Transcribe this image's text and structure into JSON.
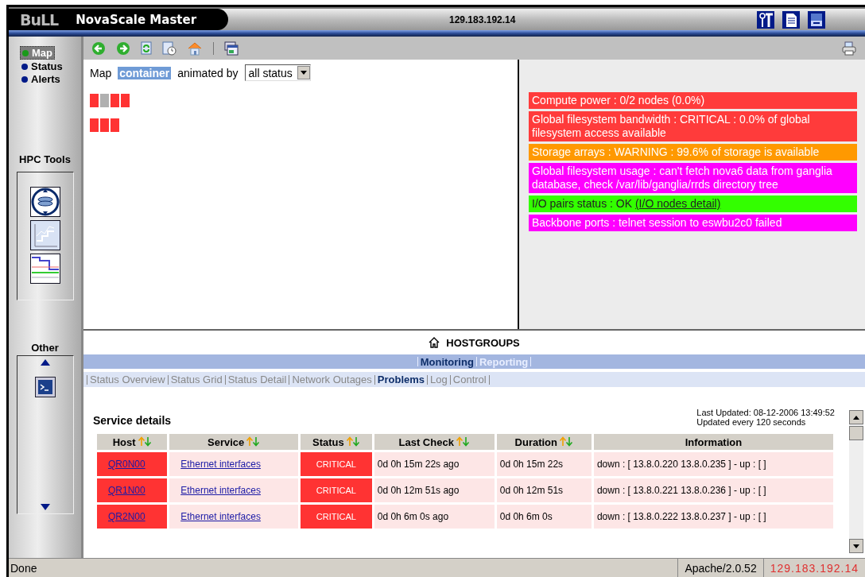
{
  "header": {
    "logo": "BuLL",
    "title": "NovaScale Master",
    "address": "129.183.192.14"
  },
  "sidebar": {
    "items": [
      {
        "label": "Map",
        "selected": true
      },
      {
        "label": "Status",
        "selected": false
      },
      {
        "label": "Alerts",
        "selected": false
      }
    ],
    "sections": [
      {
        "title": "HPC Tools"
      },
      {
        "title": "Other"
      }
    ]
  },
  "map": {
    "label": "Map",
    "container": "container",
    "animated_label": "animated by",
    "select": "all status",
    "node_rows": [
      [
        {
          "color": "#ff3333"
        },
        {
          "color": "#b0b0b0"
        },
        {
          "color": "#ff3333"
        },
        {
          "color": "#ff3333"
        }
      ],
      [
        {
          "color": "#ff3333"
        },
        {
          "color": "#ff3333"
        },
        {
          "color": "#ff3333"
        }
      ]
    ],
    "alerts": [
      {
        "text": "Compute power : 0/2 nodes (0.0%)",
        "color": "#ff3b3b"
      },
      {
        "text": "Global filesystem bandwidth : CRITICAL : 0.0% of global filesystem access available",
        "color": "#ff3b3b"
      },
      {
        "text": "Storage arrays : WARNING : 99.6% of storage is available",
        "color": "#ff9900"
      },
      {
        "text": "Global filesystem usage : can't fetch nova6 data from ganglia database, check /var/lib/ganglia/rrds directory tree",
        "color": "#ff00ff"
      },
      {
        "text": "I/O pairs status : OK",
        "link": "(I/O nodes detail)",
        "color": "#33ff00"
      },
      {
        "text": "Backbone ports : telnet session to eswbu2c0 failed",
        "color": "#ff00ff"
      }
    ]
  },
  "hostgroups": {
    "title": "HOSTGROUPS",
    "tabs": [
      {
        "label": "Monitoring",
        "selected": true
      },
      {
        "label": "Reporting",
        "selected": false
      }
    ],
    "subnav": [
      {
        "label": "Status Overview",
        "selected": false
      },
      {
        "label": "Status Grid",
        "selected": false
      },
      {
        "label": "Status Detail",
        "selected": false
      },
      {
        "label": "Network Outages",
        "selected": false
      },
      {
        "label": "Problems",
        "selected": true
      },
      {
        "label": "Log",
        "selected": false
      },
      {
        "label": "Control",
        "selected": false
      }
    ]
  },
  "service_details": {
    "title": "Service details",
    "last_updated": "Last Updated: 08-12-2006 13:49:52",
    "update_interval": "Updated every 120 seconds",
    "columns": [
      {
        "label": "Host",
        "sortable": true
      },
      {
        "label": "Service",
        "sortable": true
      },
      {
        "label": "Status",
        "sortable": true
      },
      {
        "label": "Last Check",
        "sortable": true
      },
      {
        "label": "Duration",
        "sortable": true
      },
      {
        "label": "Information",
        "sortable": false
      }
    ],
    "rows": [
      {
        "host": "QR0N00",
        "service": "Ethernet interfaces",
        "status": "CRITICAL",
        "last_check": "0d 0h 15m 22s ago",
        "duration": "0d 0h 15m 22s",
        "information": "down : [ 13.8.0.220 13.8.0.235 ] - up : [ ]"
      },
      {
        "host": "QR1N00",
        "service": "Ethernet interfaces",
        "status": "CRITICAL",
        "last_check": "0d 0h 12m 51s ago",
        "duration": "0d 0h 12m 51s",
        "information": "down : [ 13.8.0.221 13.8.0.236 ] - up : [ ]"
      },
      {
        "host": "QR2N00",
        "service": "Ethernet interfaces",
        "status": "CRITICAL",
        "last_check": "0d 0h 6m 0s ago",
        "duration": "0d 0h 6m 0s",
        "information": "down : [ 13.8.0.222 13.8.0.237 ] - up : [ ]"
      }
    ]
  },
  "status_bar": {
    "message": "Done",
    "server": "Apache/2.0.52",
    "address": "129.183.192.14"
  }
}
